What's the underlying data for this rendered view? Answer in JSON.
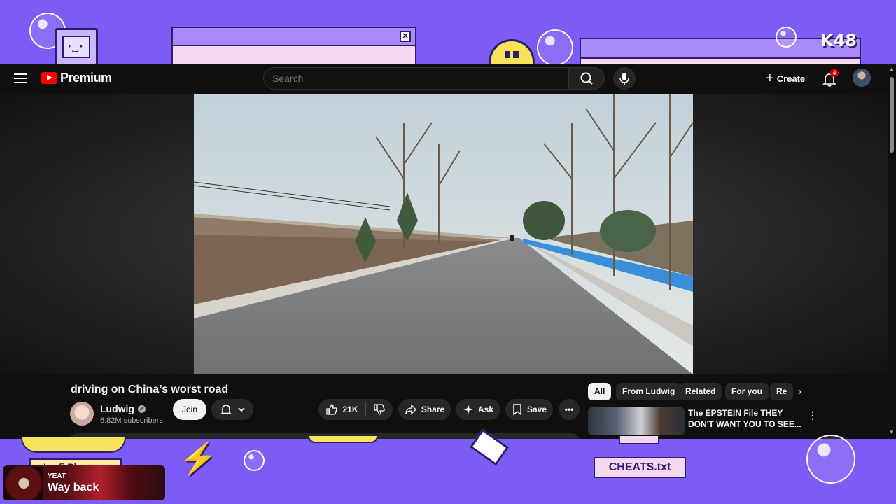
{
  "app": {
    "logo_label": "Premium",
    "search_placeholder": "Search",
    "create_label": "Create",
    "notification_count": "4"
  },
  "overlay": {
    "k48_label": "K48",
    "lofi_label": "Lo-fi Player",
    "cheats_label": "CHEATS.txt",
    "now_playing": {
      "artist": "YEAT",
      "title": "Way back"
    }
  },
  "video": {
    "title": "driving on China’s worst road",
    "channel": "Ludwig",
    "subscribers": "6.82M subscribers",
    "join_label": "Join",
    "likes": "21K",
    "share_label": "Share",
    "ask_label": "Ask",
    "save_label": "Save"
  },
  "sidebar": {
    "chips": [
      "All",
      "From Ludwig",
      "Related",
      "For you",
      "Re"
    ],
    "recommendation": {
      "title": "The EPSTEIN File THEY DON'T WANT YOU TO SEE..."
    }
  },
  "colors": {
    "overlay_bg": "#7d5bf5",
    "yt_bg": "#0f0f0f",
    "brand_red": "#ff0000",
    "guardrail_blue": "#3b8fd9"
  }
}
